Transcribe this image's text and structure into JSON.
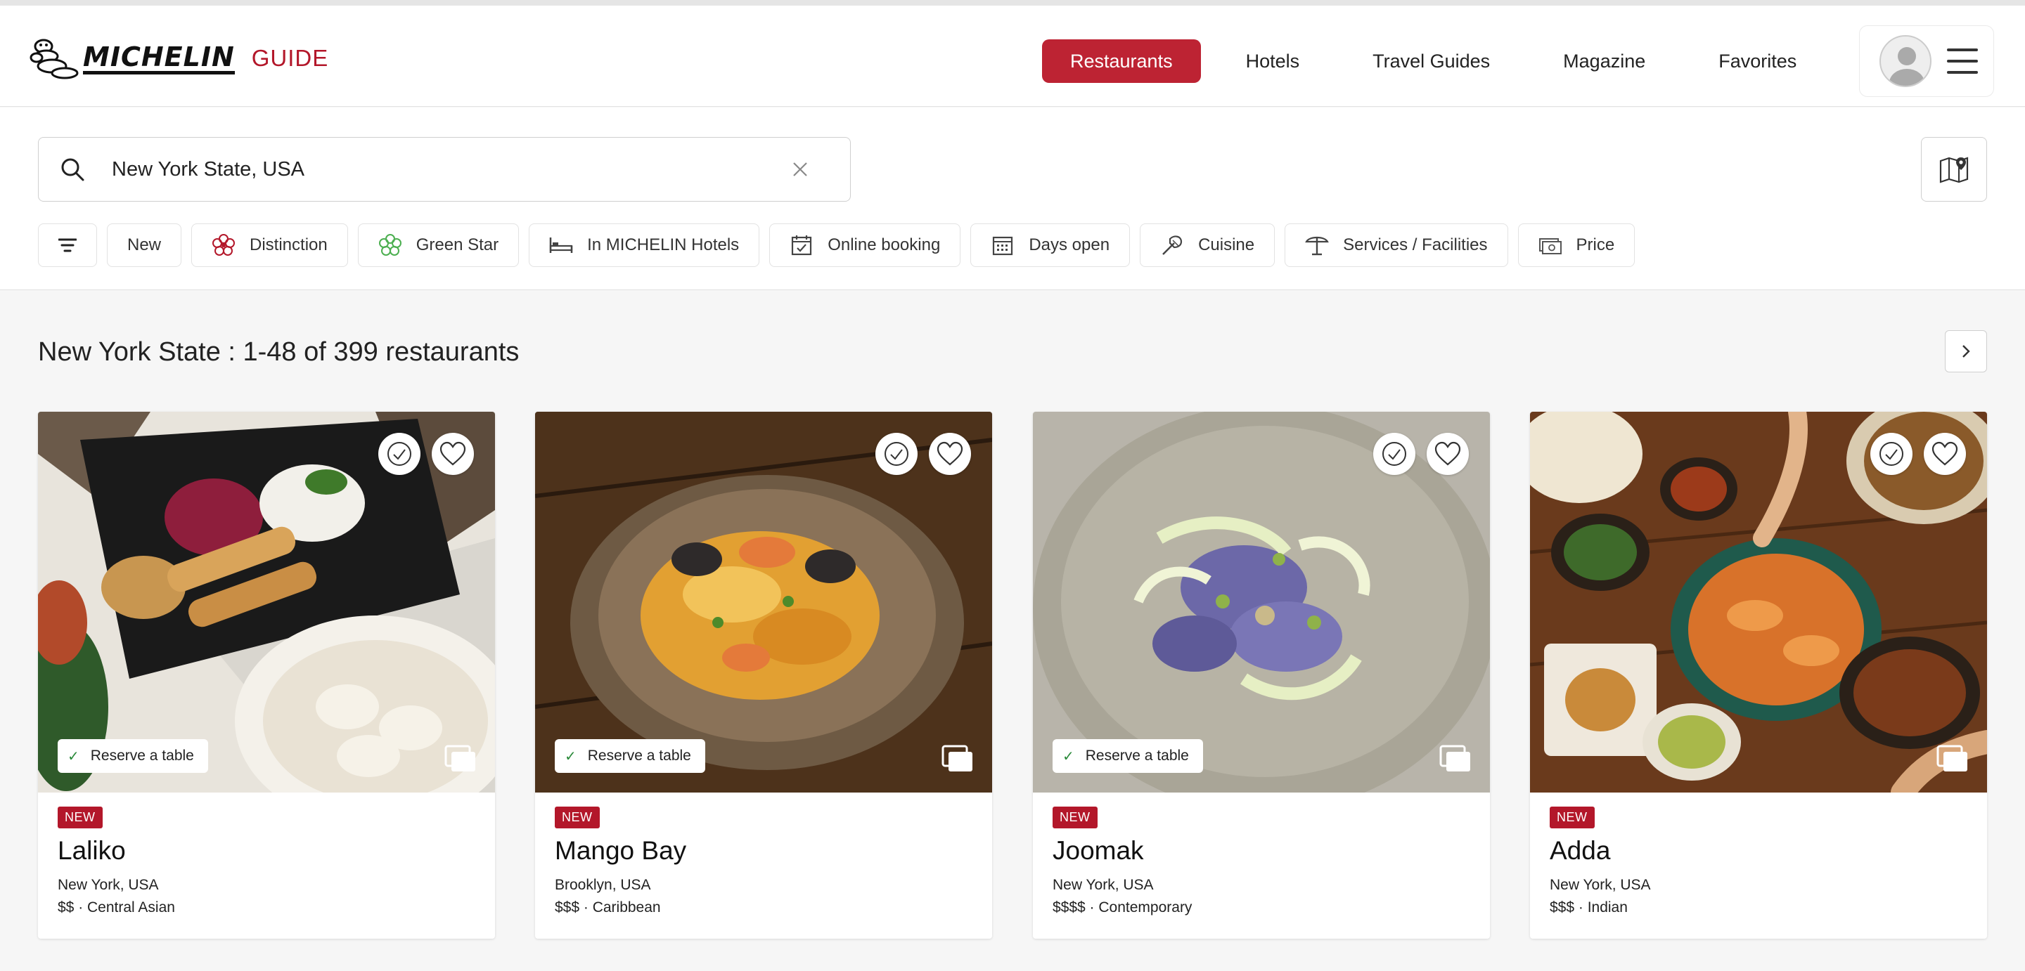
{
  "header": {
    "brand": "MICHELIN",
    "guide": "GUIDE",
    "nav": [
      {
        "label": "Restaurants",
        "active": true
      },
      {
        "label": "Hotels",
        "active": false
      },
      {
        "label": "Travel Guides",
        "active": false
      },
      {
        "label": "Magazine",
        "active": false
      },
      {
        "label": "Favorites",
        "active": false
      }
    ]
  },
  "search": {
    "value": "New York State, USA"
  },
  "filters": [
    {
      "label": "New",
      "icon": "none"
    },
    {
      "label": "Distinction",
      "icon": "flower-icon"
    },
    {
      "label": "Green Star",
      "icon": "green-star-icon"
    },
    {
      "label": "In MICHELIN Hotels",
      "icon": "bed-icon"
    },
    {
      "label": "Online booking",
      "icon": "calendar-check-icon"
    },
    {
      "label": "Days open",
      "icon": "calendar-grid-icon"
    },
    {
      "label": "Cuisine",
      "icon": "cuisine-icon"
    },
    {
      "label": "Services / Facilities",
      "icon": "parasol-icon"
    },
    {
      "label": "Price",
      "icon": "money-icon"
    }
  ],
  "results": {
    "title": "New York State : 1-48 of 399 restaurants"
  },
  "cards": [
    {
      "badge": "NEW",
      "name": "Laliko",
      "location": "New York, USA",
      "meta": "$$ · Central Asian",
      "reserve": "Reserve a table"
    },
    {
      "badge": "NEW",
      "name": "Mango Bay",
      "location": "Brooklyn, USA",
      "meta": "$$$ · Caribbean",
      "reserve": "Reserve a table"
    },
    {
      "badge": "NEW",
      "name": "Joomak",
      "location": "New York, USA",
      "meta": "$$$$ · Contemporary",
      "reserve": "Reserve a table"
    },
    {
      "badge": "NEW",
      "name": "Adda",
      "location": "New York, USA",
      "meta": "$$$ · Indian",
      "reserve": ""
    }
  ],
  "colors": {
    "accent": "#bd2333",
    "brand_red": "#b3172a",
    "check_green": "#2a8a3a"
  }
}
